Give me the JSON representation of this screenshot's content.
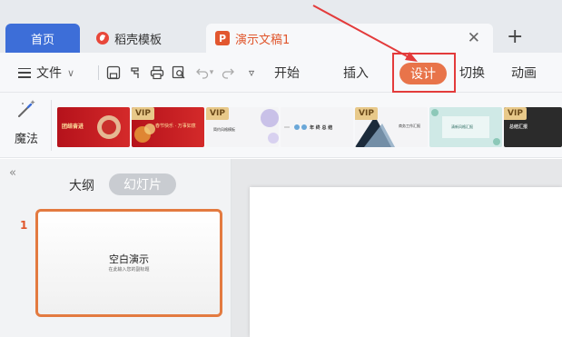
{
  "tabs": {
    "home": "首页",
    "docer": "稻壳模板",
    "presentation": "演示文稿1",
    "close_icon": "close-icon",
    "add_icon": "plus-icon"
  },
  "menu": {
    "file": "文件",
    "start": "开始",
    "insert": "插入",
    "design": "设计",
    "transition": "切换",
    "animation": "动画"
  },
  "templates": {
    "vip_badge": "VIP",
    "magic_label": "魔法",
    "thumb1_text": "团结奋进",
    "thumb2_text": "春节快乐 · 万事如意",
    "thumb3_text": "简约风格模板",
    "thumb4_text": "年 终 总 结",
    "thumb5_text": "商务工作汇报",
    "thumb6_text": "清新风格汇报",
    "thumb7_text": "总结汇报"
  },
  "panel": {
    "outline_tab": "大纲",
    "slides_tab": "幻灯片",
    "slide_number": "1",
    "slide_title": "空白演示",
    "slide_subtitle": "在此输入您的副标题"
  },
  "colors": {
    "home_tab": "#3d6ed8",
    "design_button": "#e8744a",
    "highlight_box": "#e33b3b",
    "slide_border": "#e37a40"
  }
}
